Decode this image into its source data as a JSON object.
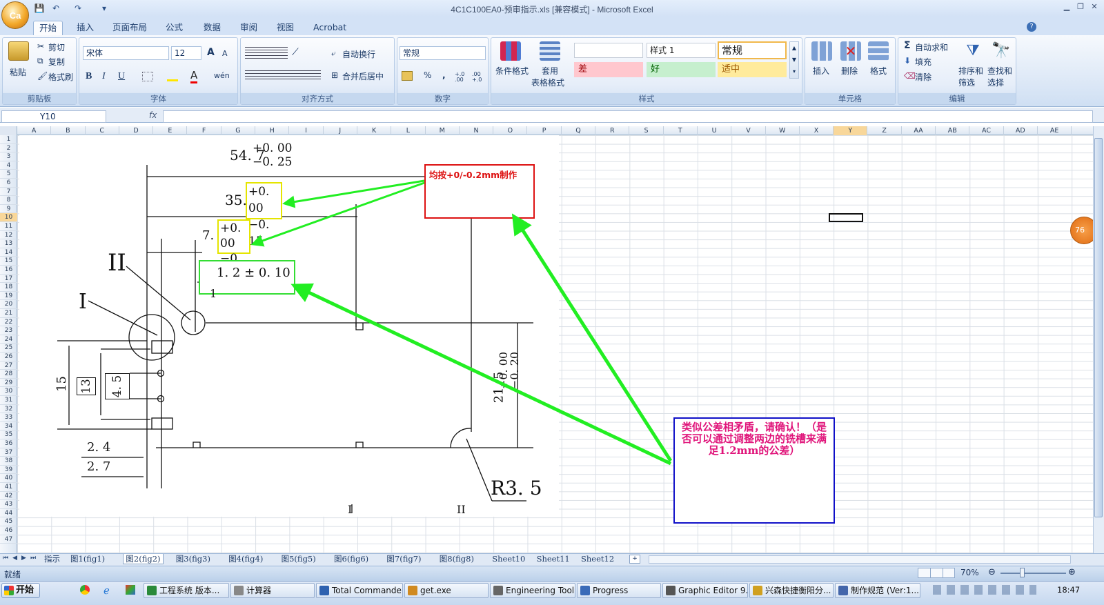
{
  "window": {
    "title": "4C1C100EA0-预审指示.xls  [兼容模式] - Microsoft Excel",
    "office_button": "Ca"
  },
  "quick_access": {
    "save": "💾",
    "undo": "↶",
    "redo": "↷",
    "more": "▾"
  },
  "tabs": [
    "开始",
    "插入",
    "页面布局",
    "公式",
    "数据",
    "审阅",
    "视图",
    "Acrobat"
  ],
  "ribbon": {
    "clipboard": {
      "label": "剪贴板",
      "paste": "粘贴",
      "cut": "剪切",
      "copy": "复制",
      "format_painter": "格式刷"
    },
    "font": {
      "label": "字体",
      "font_name": "宋体",
      "font_size": "12",
      "grow": "A",
      "shrink": "A",
      "bold": "B",
      "italic": "I",
      "underline": "U",
      "phonetic": "wén"
    },
    "alignment": {
      "label": "对齐方式",
      "wrap": "自动换行",
      "merge": "合并后居中"
    },
    "number": {
      "label": "数字",
      "format": "常规",
      "percent": "%",
      "comma": ",",
      "inc": "+.0 .00",
      "dec": ".00 +.0"
    },
    "styles": {
      "label": "样式",
      "conditional": "条件格式",
      "table_format_1": "套用",
      "table_format_2": "表格格式",
      "style1": "样式 1",
      "normal": "常规",
      "bad": "差",
      "good": "好",
      "neutral": "适中"
    },
    "cells": {
      "label": "单元格",
      "insert": "插入",
      "delete": "删除",
      "format": "格式"
    },
    "editing": {
      "label": "编辑",
      "autosum": "自动求和",
      "fill": "填充",
      "clear": "清除",
      "sort_1": "排序和",
      "sort_2": "筛选",
      "find_1": "查找和",
      "find_2": "选择"
    }
  },
  "formula_bar": {
    "name_box": "Y10",
    "fx": "fx",
    "content": ""
  },
  "columns": [
    "A",
    "B",
    "C",
    "D",
    "E",
    "F",
    "G",
    "H",
    "I",
    "J",
    "K",
    "L",
    "M",
    "N",
    "O",
    "P",
    "Q",
    "R",
    "S",
    "T",
    "U",
    "V",
    "W",
    "X",
    "Y",
    "Z",
    "AA",
    "AB",
    "AC",
    "AD",
    "AE"
  ],
  "selected_column": "Y",
  "rows": 47,
  "selected_row": 10,
  "drawing": {
    "d1_main": "54. 7",
    "d1_tol_top": "+0. 00",
    "d1_tol_bot": "−0. 25",
    "d2_main": "35. 4",
    "d2_tol_top": "+0. 00",
    "d2_tol_bot": "−0. 15",
    "d3_main": "7. 9",
    "d3_tol_top": "+0. 00",
    "d3_tol_bot": "−0. 15",
    "d4": "1. 2 ± 0. 10",
    "d5": "1",
    "label_II": "II",
    "label_I": "I",
    "d15": "15",
    "d13": "13",
    "d45": "4. 5",
    "d24": "2. 4",
    "d27": "2. 7",
    "d_right": "21. 5",
    "d_right_tol_top": "+0. 00",
    "d_right_tol_bot": "−0. 20",
    "r35": "R3. 5",
    "bottom_I": "I",
    "bottom_II": "II"
  },
  "notes": {
    "red_box": "均按+0/-0.2mm制作",
    "blue_box": "类似公差相矛盾，请确认！（是否可以通过调整两边的铣槽来满足1.2mm的公差）"
  },
  "side_badge": "76",
  "sheet_tabs": [
    "指示",
    "图1(fig1)",
    "图2(fig2)",
    "图3(fig3)",
    "图4(fig4)",
    "图5(fig5)",
    "图6(fig6)",
    "图7(fig7)",
    "图8(fig8)",
    "Sheet10",
    "Sheet11",
    "Sheet12"
  ],
  "active_sheet": "图2(fig2)",
  "status": {
    "ready": "就绪",
    "zoom": "70%"
  },
  "taskbar": {
    "start": "开始",
    "items": [
      "工程系统  版本...",
      "计算器",
      "Total Commander...",
      "get.exe",
      "Engineering Toolki...",
      "Progress",
      "Graphic Editor 9.0...",
      "兴森快捷衡阳分...",
      "制作规范 (Ver:1...."
    ],
    "clock": "18:47"
  },
  "colors": {
    "accent_green": "#22ee22",
    "note_red": "#dd1111",
    "note_blue": "#1010c8",
    "highlight_yellow": "#e6e600"
  }
}
